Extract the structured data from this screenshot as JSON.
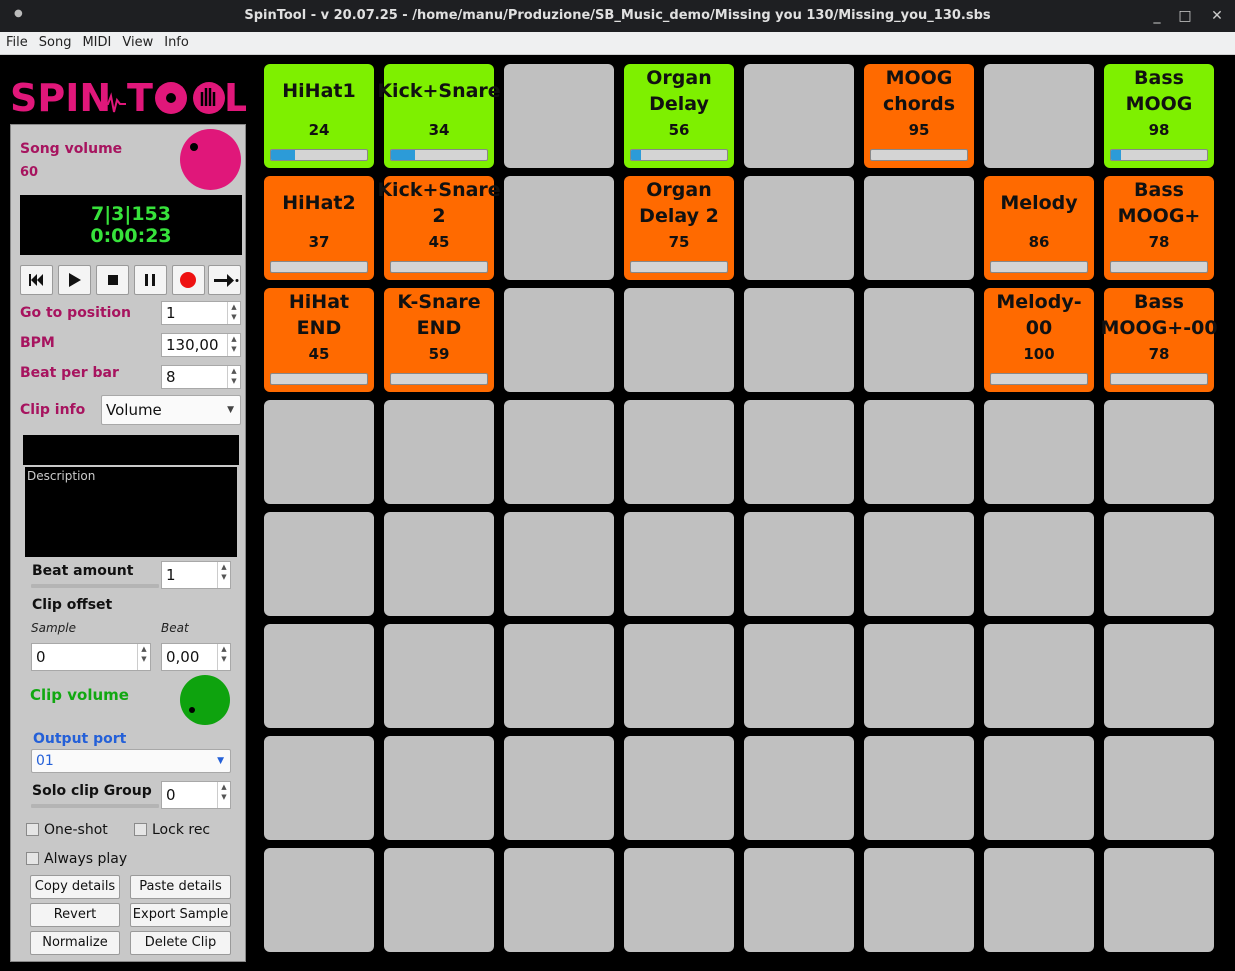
{
  "window": {
    "title": "SpinTool - v 20.07.25 - /home/manu/Produzione/SB_Music_demo/Missing you 130/Missing_you_130.sbs",
    "minimize": "_",
    "maximize": "□",
    "close": "✕"
  },
  "menu": [
    "File",
    "Song",
    "MIDI",
    "View",
    "Info"
  ],
  "logo": {
    "text_left": "SPIN",
    "text_right": "T",
    "text_end": "L",
    "accent": "#e0177a"
  },
  "song": {
    "volume_label": "Song volume",
    "volume_value": "60"
  },
  "display": {
    "position": "7|3|153",
    "time": "0:00:23"
  },
  "controls": {
    "goto_label": "Go to position",
    "goto_value": "1",
    "bpm_label": "BPM",
    "bpm_value": "130,00",
    "beats_label": "Beat per bar",
    "beats_value": "8",
    "clipinfo_label": "Clip info",
    "clipinfo_value": "Volume"
  },
  "clip": {
    "description_placeholder": "Description",
    "beat_amount_label": "Beat amount",
    "beat_amount_value": "1",
    "offset_label": "Clip offset",
    "sample_label": "Sample",
    "sample_value": "0",
    "beat_label": "Beat",
    "beat_value": "0,00",
    "volume_label": "Clip volume",
    "output_label": "Output port",
    "output_value": "01",
    "solo_label": "Solo clip Group",
    "solo_value": "0",
    "oneshot_label": "One-shot",
    "lockrec_label": "Lock rec",
    "alwaysplay_label": "Always play",
    "copy_label": "Copy details",
    "paste_label": "Paste details",
    "revert_label": "Revert",
    "export_label": "Export Sample",
    "normalize_label": "Normalize",
    "delete_label": "Delete Clip"
  },
  "colors": {
    "green": "#7ef000",
    "orange": "#ff6a00",
    "empty": "#c0c0c0",
    "progress": "#2c9bd8"
  },
  "pads": [
    [
      {
        "name": "HiHat1",
        "value": "24",
        "color": "green",
        "progress": 0.25
      },
      {
        "name": "Kick+Snare",
        "value": "34",
        "color": "green",
        "progress": 0.25
      },
      null,
      {
        "name": "Organ Delay",
        "value": "56",
        "color": "green",
        "progress": 0.1
      },
      null,
      {
        "name": "MOOG chords",
        "value": "95",
        "color": "orange",
        "progress": 0
      },
      null,
      {
        "name": "Bass MOOG",
        "value": "98",
        "color": "green",
        "progress": 0.1
      }
    ],
    [
      {
        "name": "HiHat2",
        "value": "37",
        "color": "orange",
        "progress": 0
      },
      {
        "name": "Kick+Snare 2",
        "value": "45",
        "color": "orange",
        "progress": 0
      },
      null,
      {
        "name": "Organ Delay 2",
        "value": "75",
        "color": "orange",
        "progress": 0
      },
      null,
      null,
      {
        "name": "Melody",
        "value": "86",
        "color": "orange",
        "progress": 0
      },
      {
        "name": "Bass MOOG+",
        "value": "78",
        "color": "orange",
        "progress": 0
      }
    ],
    [
      {
        "name": "HiHat END",
        "value": "45",
        "color": "orange",
        "progress": 0
      },
      {
        "name": "K-Snare END",
        "value": "59",
        "color": "orange",
        "progress": 0
      },
      null,
      null,
      null,
      null,
      {
        "name": "Melody-00",
        "value": "100",
        "color": "orange",
        "progress": 0
      },
      {
        "name": "Bass MOOG+-00",
        "value": "78",
        "color": "orange",
        "progress": 0
      }
    ],
    [
      null,
      null,
      null,
      null,
      null,
      null,
      null,
      null
    ],
    [
      null,
      null,
      null,
      null,
      null,
      null,
      null,
      null
    ],
    [
      null,
      null,
      null,
      null,
      null,
      null,
      null,
      null
    ],
    [
      null,
      null,
      null,
      null,
      null,
      null,
      null,
      null
    ],
    [
      null,
      null,
      null,
      null,
      null,
      null,
      null,
      null
    ]
  ]
}
